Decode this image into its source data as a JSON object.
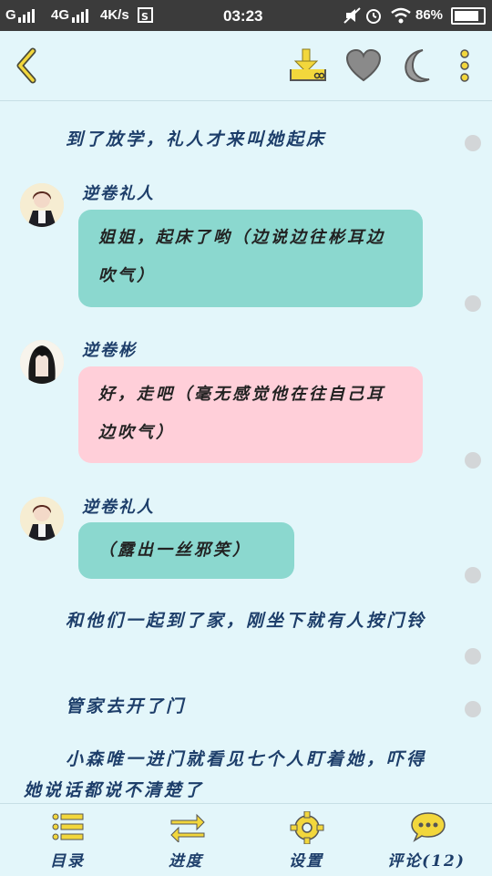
{
  "status_bar": {
    "carrier": "G",
    "network": "4G",
    "speed": "4K/s",
    "time": "03:23",
    "battery": "86%",
    "battery_level": 0.86
  },
  "toolbar": {
    "back": "back-icon",
    "download": "download-icon",
    "favorite": "heart-icon",
    "night_mode": "moon-icon",
    "more": "more-vertical-icon"
  },
  "content": {
    "para1": "到了放学，礼人才来叫她起床",
    "msg1": {
      "name": "逆卷礼人",
      "text": "姐姐，起床了哟（边说边往彬耳边吹气）",
      "bubble_color": "#8bd8cf"
    },
    "msg2": {
      "name": "逆卷彬",
      "text": "好，走吧（毫无感觉他在往自己耳边吹气）",
      "bubble_color": "#ffcfd9"
    },
    "msg3": {
      "name": "逆卷礼人",
      "text": "（露出一丝邪笑）",
      "bubble_color": "#8bd8cf"
    },
    "para2": "和他们一起到了家，刚坐下就有人按门铃",
    "para3": "管家去开了门",
    "para4": "小森唯一进门就看见七个人盯着她，吓得她说话都说不清楚了"
  },
  "bottom_nav": {
    "toc": "目录",
    "progress": "进度",
    "settings": "设置",
    "comments": "评论(12)"
  }
}
